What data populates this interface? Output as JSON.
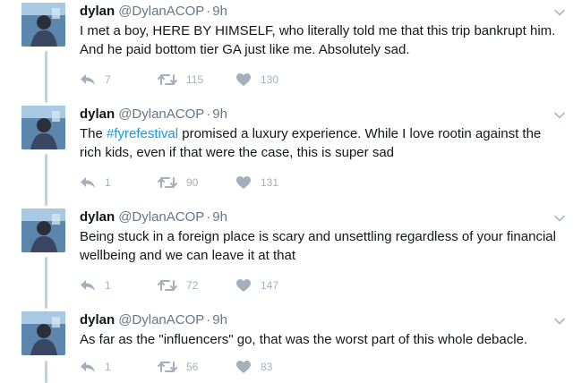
{
  "tweets": [
    {
      "name": "dylan",
      "handle": "@DylanACOP",
      "dot": "·",
      "time": "9h",
      "text_before": "I met a boy, HERE BY HIMSELF, who literally told me that this trip bankrupt him. And he paid bottom tier GA just like me. Absolutely sad.",
      "hashtag": "",
      "text_after": "",
      "replies": "7",
      "retweets": "115",
      "likes": "130"
    },
    {
      "name": "dylan",
      "handle": "@DylanACOP",
      "dot": "·",
      "time": "9h",
      "text_before": "The ",
      "hashtag": "#fyrefestival",
      "text_after": " promised a luxury experience. While I love rootin against the rich kids, even if that were the case, this is super sad",
      "replies": "1",
      "retweets": "90",
      "likes": "131"
    },
    {
      "name": "dylan",
      "handle": "@DylanACOP",
      "dot": "·",
      "time": "9h",
      "text_before": "Being stuck in a foreign place is scary and unsettling regardless of your financial wellbeing and we can leave it at that",
      "hashtag": "",
      "text_after": "",
      "replies": "1",
      "retweets": "72",
      "likes": "147"
    },
    {
      "name": "dylan",
      "handle": "@DylanACOP",
      "dot": "·",
      "time": "9h",
      "text_before": "As far as the \"influencers\" go, that was the worst part of this whole debacle.",
      "hashtag": "",
      "text_after": "",
      "replies": "1",
      "retweets": "56",
      "likes": "83"
    }
  ],
  "icons": {
    "reply": "reply-icon",
    "retweet": "retweet-icon",
    "like": "heart-icon",
    "menu": "chevron-down-icon"
  },
  "colors": {
    "hashtag": "#1b95e0",
    "action_gray": "#a3b0bb",
    "thread_line": "#c4d0da"
  }
}
